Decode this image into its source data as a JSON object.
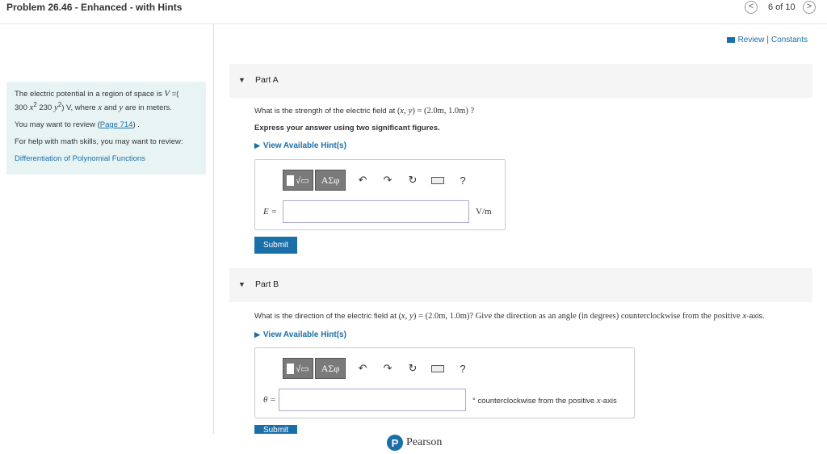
{
  "header": {
    "title": "Problem 26.46 - Enhanced - with Hints",
    "counter": "6 of 10",
    "prev_glyph": "<",
    "next_glyph": ">"
  },
  "links": {
    "review": "Review",
    "separator": "|",
    "constants": "Constants"
  },
  "left_panel": {
    "intro_a": "The electric potential in a region of space is ",
    "V": "V",
    "intro_b": " =(",
    "c1": "300 ",
    "x2": "x",
    "sup2a": "2",
    "c2": "   230 ",
    "y2": "y",
    "sup2b": "2",
    "units_a": ") V, where ",
    "x": "x",
    "and": " and ",
    "y": "y",
    "units_b": " are in meters.",
    "review_text": "You may want to review (",
    "review_link": "Page 714",
    "review_end": ") .",
    "help_text": "For help with math skills, you may want to review:",
    "help_link": "Differentiation of Polynomial Functions"
  },
  "part_a": {
    "label": "Part A",
    "question_a": "What is the strength of the electric field at (",
    "question_xy": "x, y",
    "question_b": ") = (2.0m, 1.0m) ?",
    "instruction": "Express your answer using two significant figures.",
    "hint": "View Available Hint(s)",
    "eq_label": "E =",
    "unit": "V/m",
    "submit": "Submit"
  },
  "part_b": {
    "label": "Part B",
    "question_a": "What is the direction of the electric field at (",
    "question_xy": "x, y",
    "question_b": ") = (2.0m, 1.0m)? Give the direction as an angle (in degrees) counterclockwise from the positive ",
    "question_x": "x",
    "question_c": "-axis.",
    "hint": "View Available Hint(s)",
    "eq_label": "θ =",
    "unit_a": "° counterclockwise from the positive ",
    "unit_x": "x",
    "unit_b": "-axis",
    "submit": "Submit"
  },
  "toolbar": {
    "greek": "ΑΣφ",
    "undo": "↶",
    "redo": "↷",
    "reset": "↻",
    "help": "?"
  },
  "footer": {
    "logo": "P",
    "brand": "Pearson"
  }
}
